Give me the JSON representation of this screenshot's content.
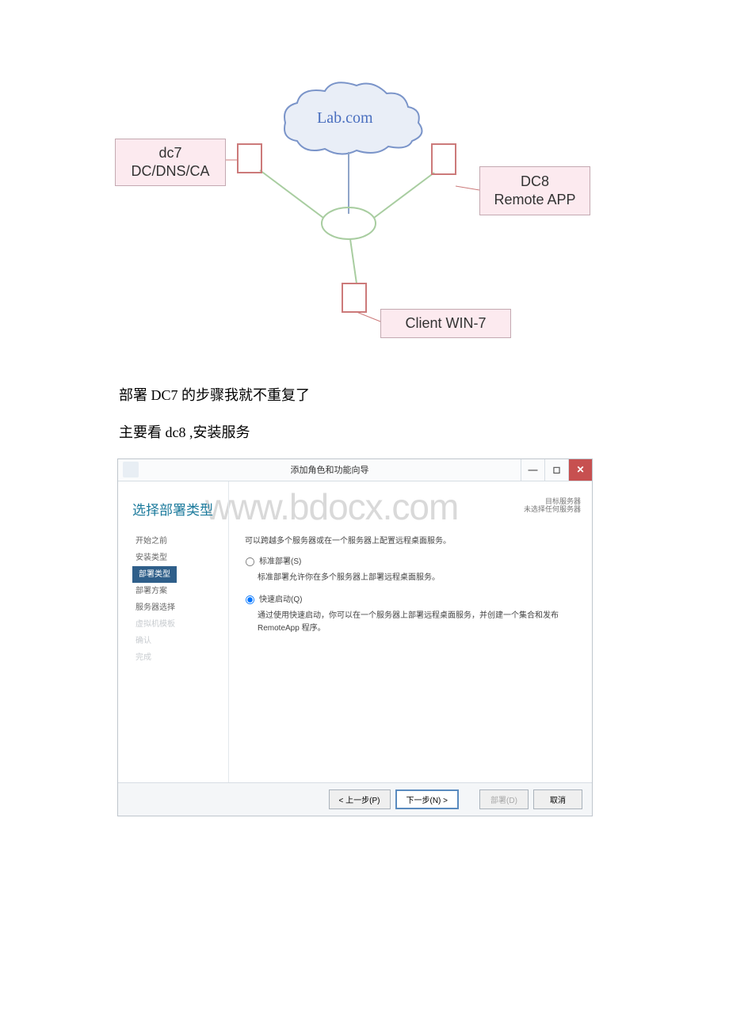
{
  "diagram": {
    "cloud_label": "Lab.com",
    "node_dc7_line1": "dc7",
    "node_dc7_line2": "DC/DNS/CA",
    "node_dc8_line1": "DC8",
    "node_dc8_line2": "Remote APP",
    "node_client": "Client WIN-7"
  },
  "text": {
    "line1": "部署 DC7 的步骤我就不重复了",
    "line2": "主要看 dc8 ,安装服务"
  },
  "watermark": "www.bdocx.com",
  "wizard": {
    "title": "添加角色和功能向导",
    "heading": "选择部署类型",
    "target_label": "目标服务器",
    "target_value": "未选择任何服务器",
    "sidebar": {
      "s0": "开始之前",
      "s1": "安装类型",
      "s2": "部署类型",
      "s3": "部署方案",
      "s4": "服务器选择",
      "s5": "虚拟机模板",
      "s6": "确认",
      "s7": "完成"
    },
    "content": {
      "intro": "可以跨越多个服务器或在一个服务器上配置远程桌面服务。",
      "opt1_label": "标准部署(S)",
      "opt1_desc": "标准部署允许你在多个服务器上部署远程桌面服务。",
      "opt2_label": "快速启动(Q)",
      "opt2_desc": "通过使用快速启动，你可以在一个服务器上部署远程桌面服务，并创建一个集合和发布 RemoteApp 程序。"
    },
    "buttons": {
      "prev": "< 上一步(P)",
      "next": "下一步(N) >",
      "deploy": "部署(D)",
      "cancel": "取消"
    }
  }
}
